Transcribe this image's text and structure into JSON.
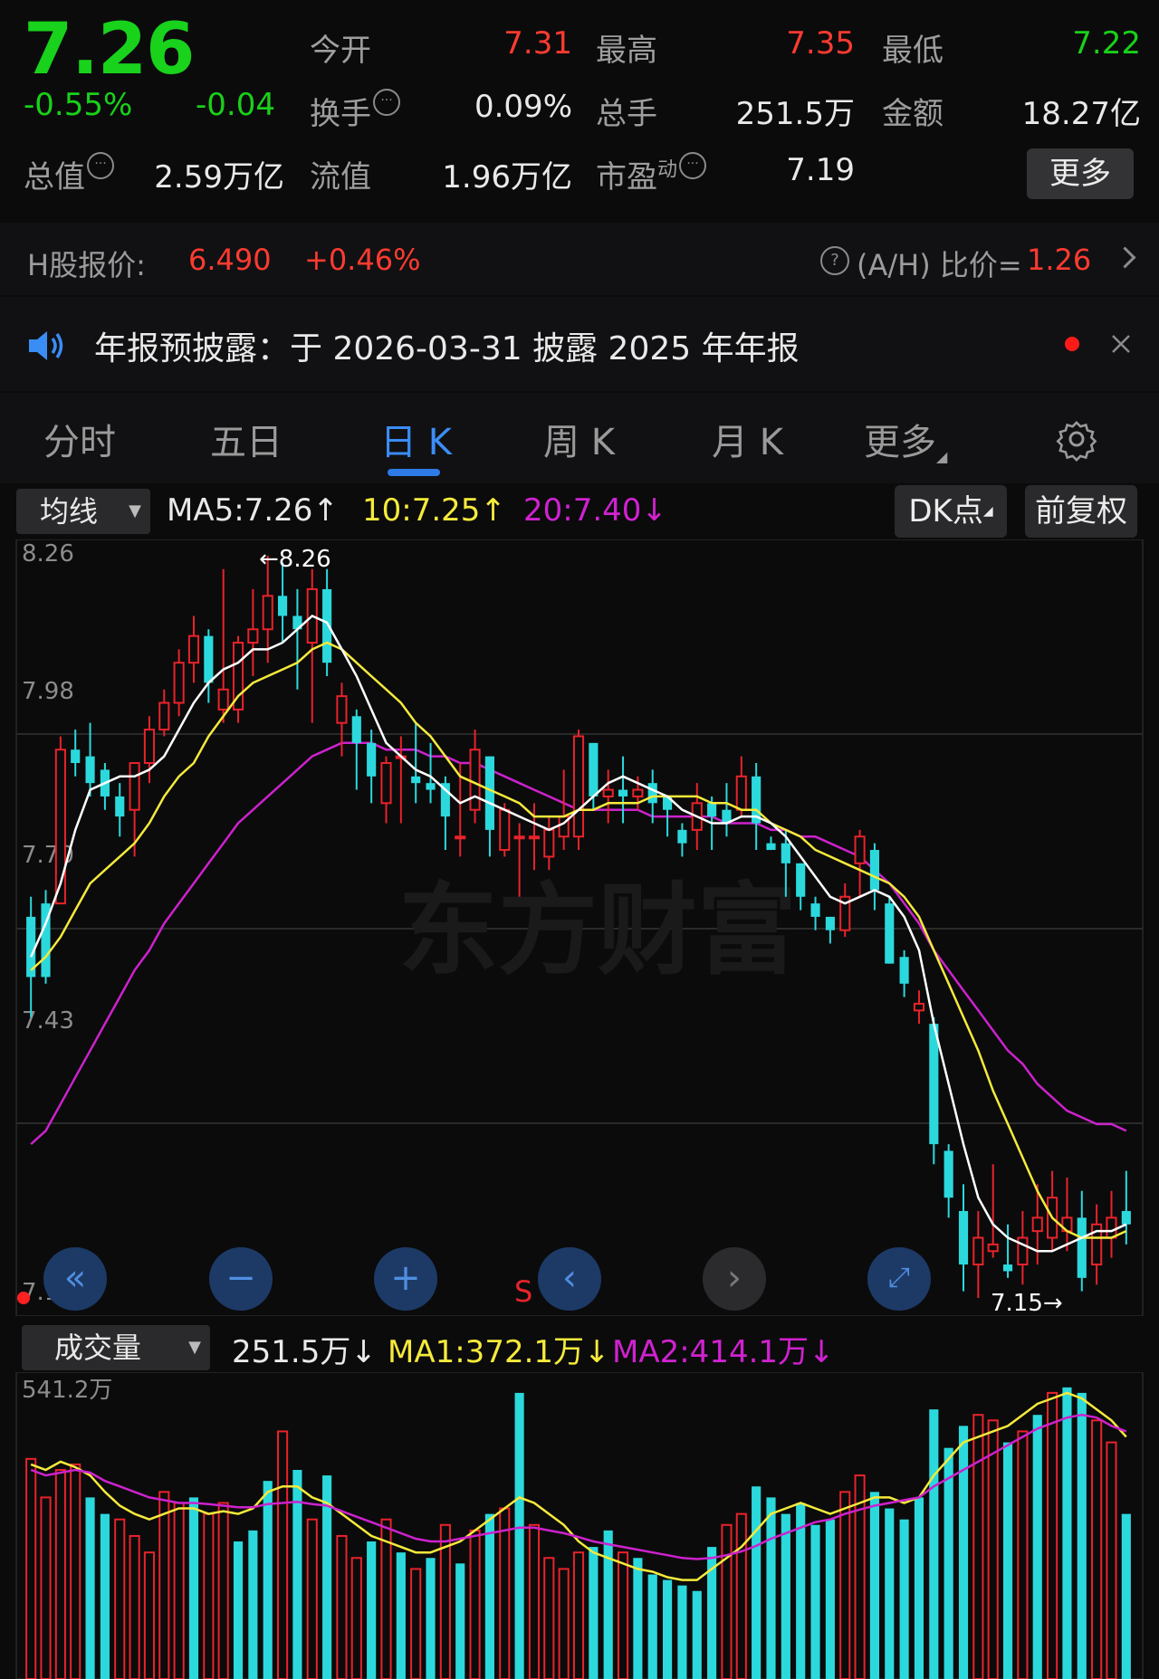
{
  "quote": {
    "price": "7.26",
    "change_pct": "-0.55%",
    "change": "-0.04",
    "open_label": "今开",
    "open_value": "7.31",
    "high_label": "最高",
    "high_value": "7.35",
    "low_label": "最低",
    "low_value": "7.22",
    "turnover_label": "换手",
    "turnover_value": "0.09%",
    "volume_label": "总手",
    "volume_value": "251.5万",
    "amount_label": "金额",
    "amount_value": "18.27亿",
    "mktcap_label": "总值",
    "mktcap_value": "2.59万亿",
    "float_label": "流值",
    "float_value": "1.96万亿",
    "pe_label": "市盈",
    "pe_sup": "动",
    "pe_value": "7.19",
    "more_label": "更多"
  },
  "hshare": {
    "label": "H股报价:",
    "price": "6.490",
    "change_pct": "+0.46%",
    "ratio_label": "(A/H) 比价=",
    "ratio_value": "1.26"
  },
  "notice": {
    "text": "年报预披露：于 2026-03-31 披露 2025 年年报"
  },
  "tabs": [
    {
      "label": "分时"
    },
    {
      "label": "五日"
    },
    {
      "label": "日 K"
    },
    {
      "label": "周 K"
    },
    {
      "label": "月 K"
    },
    {
      "label": "更多"
    }
  ],
  "ma_bar": {
    "select_label": "均线",
    "ma5": "MA5:7.26",
    "ma10": "10:7.25",
    "ma20": "20:7.40",
    "dk_label": "DK点",
    "adj_label": "前复权"
  },
  "volume_bar": {
    "select_label": "成交量",
    "vol": "251.5万",
    "ma1": "MA1:372.1万",
    "ma2": "MA2:414.1万"
  },
  "colors": {
    "up": "#e8232a",
    "down": "#2bd9dd",
    "ma5": "#ffffff",
    "ma10": "#f5ea3b",
    "ma20": "#cc22cc",
    "accent": "#3a8df5"
  },
  "chart_data": {
    "type": "candlestick",
    "y_ticks": [
      "8.26",
      "7.98",
      "7.70",
      "7.43",
      "7.15"
    ],
    "ylim": [
      7.15,
      8.26
    ],
    "max_label": "←8.26",
    "min_label": "7.15→",
    "signal_label": "S",
    "candles": [
      [
        7.72,
        7.63,
        7.75,
        7.57
      ],
      [
        7.74,
        7.63,
        7.76,
        7.62
      ],
      [
        7.74,
        7.97,
        7.99,
        7.74
      ],
      [
        7.97,
        7.95,
        8.0,
        7.93
      ],
      [
        7.96,
        7.92,
        8.01,
        7.9
      ],
      [
        7.94,
        7.9,
        7.95,
        7.88
      ],
      [
        7.9,
        7.87,
        7.92,
        7.84
      ],
      [
        7.88,
        7.95,
        7.95,
        7.81
      ],
      [
        7.95,
        8.0,
        8.02,
        7.92
      ],
      [
        8.0,
        8.04,
        8.06,
        7.99
      ],
      [
        8.04,
        8.1,
        8.12,
        8.02
      ],
      [
        8.1,
        8.14,
        8.17,
        8.07
      ],
      [
        8.14,
        8.07,
        8.15,
        8.04
      ],
      [
        8.03,
        8.06,
        8.24,
        8.01
      ],
      [
        8.03,
        8.13,
        8.14,
        8.01
      ],
      [
        8.13,
        8.15,
        8.21,
        8.08
      ],
      [
        8.15,
        8.2,
        8.26,
        8.1
      ],
      [
        8.2,
        8.17,
        8.25,
        8.13
      ],
      [
        8.17,
        8.15,
        8.21,
        8.06
      ],
      [
        8.13,
        8.21,
        8.24,
        8.01
      ],
      [
        8.21,
        8.1,
        8.24,
        8.08
      ],
      [
        8.01,
        8.05,
        8.07,
        7.96
      ],
      [
        8.02,
        7.98,
        8.03,
        7.91
      ],
      [
        7.98,
        7.93,
        8.0,
        7.89
      ],
      [
        7.89,
        7.95,
        7.96,
        7.86
      ],
      [
        7.96,
        7.96,
        7.99,
        7.86
      ],
      [
        7.93,
        7.92,
        8.01,
        7.89
      ],
      [
        7.92,
        7.91,
        7.98,
        7.89
      ],
      [
        7.92,
        7.87,
        7.93,
        7.82
      ],
      [
        7.84,
        7.84,
        7.95,
        7.81
      ],
      [
        7.88,
        7.97,
        8.0,
        7.86
      ],
      [
        7.96,
        7.85,
        7.96,
        7.81
      ],
      [
        7.82,
        7.88,
        7.89,
        7.81
      ],
      [
        7.84,
        7.84,
        7.86,
        7.75
      ],
      [
        7.84,
        7.84,
        7.89,
        7.79
      ],
      [
        7.81,
        7.85,
        7.87,
        7.79
      ],
      [
        7.84,
        7.87,
        7.94,
        7.82
      ],
      [
        7.84,
        7.99,
        8.0,
        7.82
      ],
      [
        7.98,
        7.9,
        7.98,
        7.88
      ],
      [
        7.9,
        7.91,
        7.94,
        7.86
      ],
      [
        7.91,
        7.9,
        7.96,
        7.86
      ],
      [
        7.9,
        7.91,
        7.93,
        7.88
      ],
      [
        7.92,
        7.89,
        7.94,
        7.86
      ],
      [
        7.9,
        7.88,
        7.9,
        7.84
      ],
      [
        7.85,
        7.83,
        7.86,
        7.81
      ],
      [
        7.85,
        7.89,
        7.92,
        7.82
      ],
      [
        7.89,
        7.87,
        7.9,
        7.82
      ],
      [
        7.88,
        7.86,
        7.92,
        7.84
      ],
      [
        7.88,
        7.93,
        7.96,
        7.87
      ],
      [
        7.93,
        7.86,
        7.95,
        7.82
      ],
      [
        7.83,
        7.82,
        7.84,
        7.82
      ],
      [
        7.83,
        7.8,
        7.85,
        7.75
      ],
      [
        7.8,
        7.75,
        7.8,
        7.73
      ],
      [
        7.74,
        7.72,
        7.75,
        7.7
      ],
      [
        7.72,
        7.7,
        7.72,
        7.68
      ],
      [
        7.7,
        7.75,
        7.77,
        7.69
      ],
      [
        7.8,
        7.84,
        7.85,
        7.75
      ],
      [
        7.82,
        7.76,
        7.83,
        7.73
      ],
      [
        7.74,
        7.65,
        7.75,
        7.65
      ],
      [
        7.66,
        7.62,
        7.67,
        7.6
      ],
      [
        7.58,
        7.59,
        7.61,
        7.56
      ],
      [
        7.56,
        7.38,
        7.57,
        7.35
      ],
      [
        7.37,
        7.3,
        7.38,
        7.27
      ],
      [
        7.28,
        7.2,
        7.32,
        7.16
      ],
      [
        7.2,
        7.24,
        7.28,
        7.15
      ],
      [
        7.22,
        7.23,
        7.35,
        7.21
      ],
      [
        7.2,
        7.19,
        7.26,
        7.18
      ],
      [
        7.2,
        7.24,
        7.28,
        7.17
      ],
      [
        7.25,
        7.27,
        7.32,
        7.2
      ],
      [
        7.24,
        7.3,
        7.34,
        7.22
      ],
      [
        7.25,
        7.27,
        7.33,
        7.22
      ],
      [
        7.27,
        7.18,
        7.31,
        7.16
      ],
      [
        7.2,
        7.26,
        7.29,
        7.17
      ],
      [
        7.24,
        7.27,
        7.31,
        7.21
      ],
      [
        7.28,
        7.26,
        7.34,
        7.23
      ]
    ],
    "ma5": [
      7.66,
      7.71,
      7.77,
      7.85,
      7.91,
      7.92,
      7.93,
      7.93,
      7.94,
      7.96,
      8.0,
      8.04,
      8.07,
      8.09,
      8.1,
      8.12,
      8.12,
      8.13,
      8.15,
      8.17,
      8.16,
      8.12,
      8.08,
      8.03,
      7.98,
      7.96,
      7.94,
      7.93,
      7.91,
      7.89,
      7.9,
      7.89,
      7.88,
      7.87,
      7.86,
      7.85,
      7.86,
      7.88,
      7.9,
      7.92,
      7.93,
      7.92,
      7.91,
      7.9,
      7.88,
      7.87,
      7.86,
      7.86,
      7.87,
      7.87,
      7.86,
      7.84,
      7.81,
      7.78,
      7.75,
      7.74,
      7.75,
      7.76,
      7.75,
      7.72,
      7.67,
      7.56,
      7.47,
      7.38,
      7.3,
      7.26,
      7.24,
      7.23,
      7.22,
      7.22,
      7.23,
      7.24,
      7.25,
      7.25,
      7.26
    ],
    "ma10": [
      7.64,
      7.66,
      7.69,
      7.73,
      7.77,
      7.79,
      7.81,
      7.83,
      7.86,
      7.9,
      7.93,
      7.95,
      7.99,
      8.02,
      8.05,
      8.07,
      8.08,
      8.09,
      8.1,
      8.12,
      8.13,
      8.12,
      8.1,
      8.08,
      8.06,
      8.04,
      8.01,
      7.99,
      7.96,
      7.93,
      7.92,
      7.91,
      7.9,
      7.89,
      7.87,
      7.87,
      7.87,
      7.88,
      7.88,
      7.89,
      7.89,
      7.89,
      7.9,
      7.9,
      7.9,
      7.9,
      7.89,
      7.89,
      7.88,
      7.88,
      7.86,
      7.85,
      7.84,
      7.82,
      7.81,
      7.8,
      7.79,
      7.78,
      7.77,
      7.75,
      7.72,
      7.67,
      7.62,
      7.57,
      7.52,
      7.46,
      7.41,
      7.36,
      7.31,
      7.27,
      7.25,
      7.24,
      7.24,
      7.24,
      7.25
    ],
    "ma20": [
      7.38,
      7.4,
      7.44,
      7.48,
      7.52,
      7.56,
      7.6,
      7.64,
      7.67,
      7.71,
      7.74,
      7.77,
      7.8,
      7.83,
      7.86,
      7.88,
      7.9,
      7.92,
      7.94,
      7.96,
      7.97,
      7.98,
      7.98,
      7.98,
      7.97,
      7.97,
      7.97,
      7.96,
      7.96,
      7.95,
      7.95,
      7.94,
      7.93,
      7.92,
      7.91,
      7.9,
      7.89,
      7.88,
      7.88,
      7.88,
      7.88,
      7.88,
      7.87,
      7.87,
      7.87,
      7.87,
      7.87,
      7.86,
      7.86,
      7.86,
      7.85,
      7.85,
      7.84,
      7.84,
      7.83,
      7.82,
      7.81,
      7.79,
      7.77,
      7.74,
      7.71,
      7.67,
      7.64,
      7.61,
      7.58,
      7.55,
      7.52,
      7.5,
      7.47,
      7.45,
      7.43,
      7.42,
      7.41,
      7.41,
      7.4
    ],
    "volume_ylabel": "541.2万",
    "volume_ylim": [
      0,
      541.2
    ],
    "volume": [
      400,
      330,
      380,
      390,
      330,
      300,
      290,
      260,
      230,
      340,
      320,
      330,
      300,
      320,
      250,
      270,
      360,
      450,
      380,
      290,
      370,
      260,
      220,
      250,
      290,
      230,
      200,
      220,
      280,
      210,
      270,
      300,
      310,
      520,
      280,
      220,
      200,
      230,
      240,
      270,
      230,
      220,
      190,
      180,
      170,
      160,
      240,
      280,
      300,
      350,
      330,
      300,
      320,
      280,
      290,
      340,
      370,
      340,
      310,
      290,
      330,
      490,
      420,
      460,
      480,
      470,
      430,
      450,
      480,
      520,
      530,
      520,
      470,
      430,
      300
    ],
    "volume_up": [
      1,
      1,
      1,
      1,
      0,
      0,
      1,
      1,
      1,
      1,
      1,
      0,
      1,
      1,
      0,
      0,
      0,
      1,
      0,
      1,
      0,
      1,
      1,
      0,
      1,
      0,
      1,
      0,
      1,
      0,
      1,
      0,
      1,
      0,
      1,
      1,
      1,
      1,
      0,
      0,
      1,
      0,
      0,
      0,
      0,
      0,
      0,
      1,
      1,
      0,
      0,
      0,
      0,
      0,
      0,
      1,
      1,
      0,
      0,
      0,
      0,
      0,
      0,
      0,
      1,
      1,
      0,
      1,
      0,
      1,
      0,
      0,
      1,
      1,
      0
    ],
    "vol_ma1": [
      390,
      380,
      395,
      385,
      370,
      340,
      315,
      300,
      290,
      300,
      310,
      310,
      300,
      305,
      300,
      310,
      340,
      350,
      350,
      330,
      320,
      300,
      280,
      260,
      250,
      240,
      230,
      230,
      240,
      250,
      270,
      290,
      310,
      330,
      320,
      300,
      280,
      250,
      230,
      220,
      210,
      200,
      195,
      185,
      180,
      180,
      200,
      220,
      240,
      270,
      300,
      310,
      320,
      310,
      300,
      310,
      320,
      330,
      330,
      320,
      330,
      370,
      400,
      430,
      440,
      450,
      460,
      480,
      500,
      510,
      520,
      510,
      490,
      470,
      440
    ],
    "vol_ma2": [
      380,
      370,
      375,
      380,
      375,
      360,
      350,
      340,
      330,
      325,
      320,
      320,
      318,
      315,
      312,
      312,
      318,
      320,
      322,
      318,
      315,
      305,
      295,
      285,
      275,
      265,
      255,
      250,
      250,
      255,
      260,
      265,
      270,
      275,
      275,
      270,
      265,
      258,
      250,
      245,
      240,
      235,
      230,
      225,
      220,
      218,
      220,
      225,
      232,
      242,
      255,
      265,
      275,
      285,
      290,
      300,
      308,
      315,
      320,
      325,
      330,
      350,
      365,
      380,
      395,
      410,
      425,
      440,
      455,
      465,
      475,
      480,
      475,
      460,
      450
    ]
  }
}
